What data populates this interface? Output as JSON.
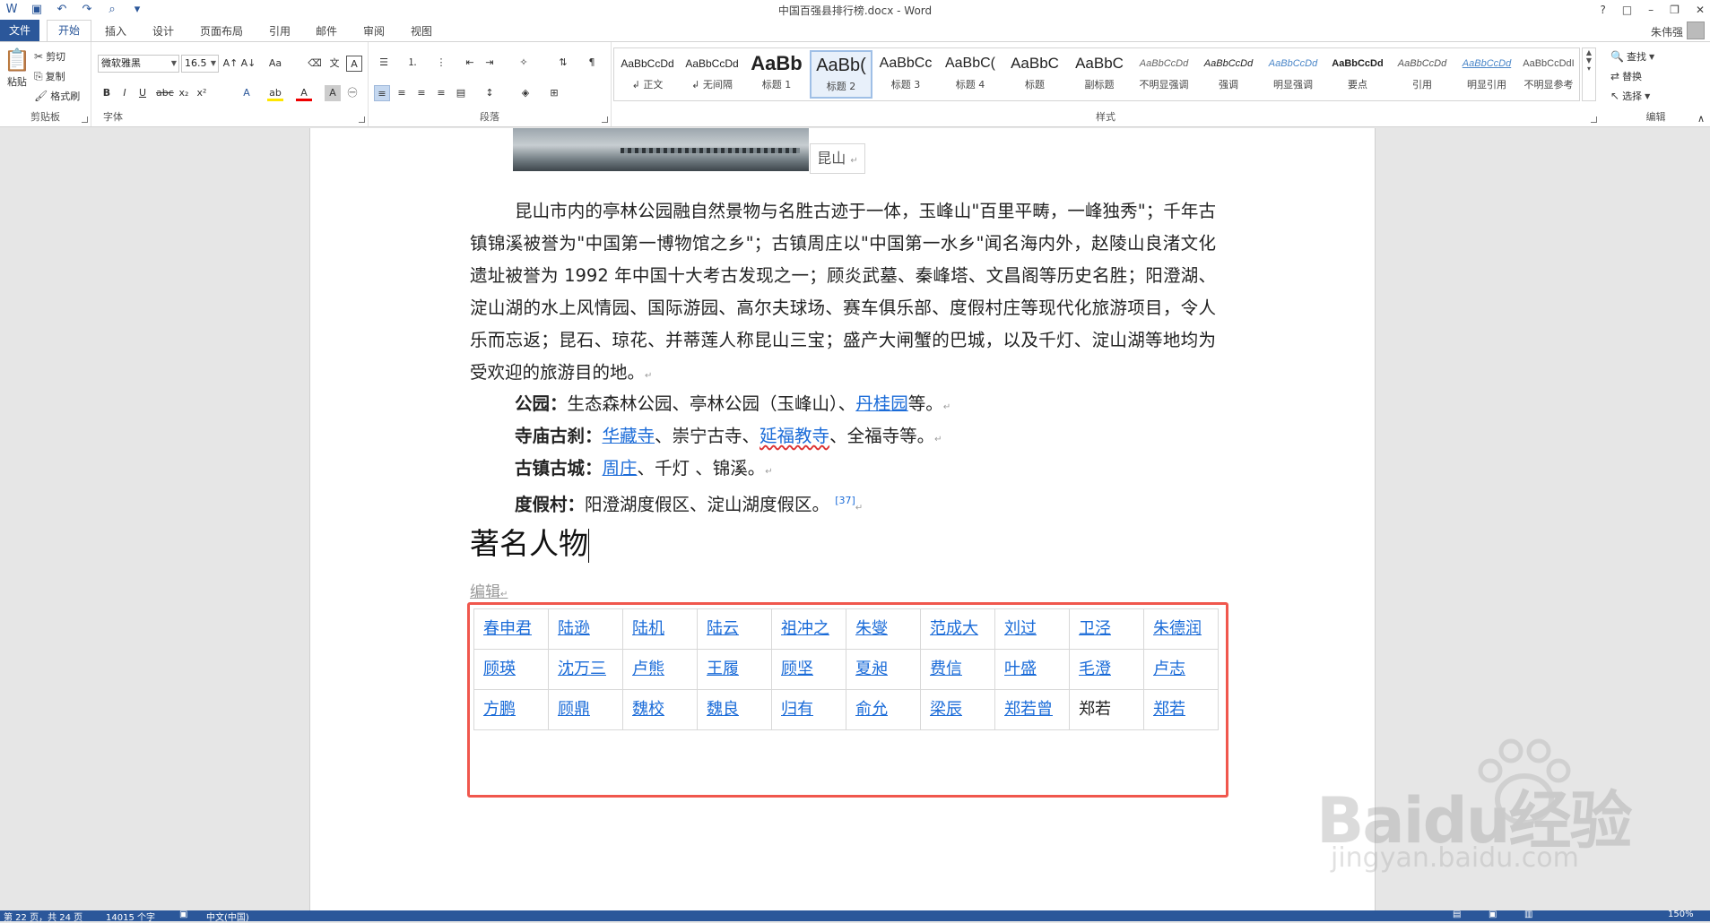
{
  "window": {
    "doc_title": "中国百强县排行榜.docx - Word",
    "controls": [
      "?",
      "□",
      "–",
      "❐",
      "✕"
    ]
  },
  "tabs": {
    "file": "文件",
    "items": [
      "开始",
      "插入",
      "设计",
      "页面布局",
      "引用",
      "邮件",
      "审阅",
      "视图"
    ],
    "active": "开始",
    "user": "朱伟强"
  },
  "ribbon": {
    "clipboard": {
      "paste": "粘贴",
      "cut": "剪切",
      "copy": "复制",
      "format_painter": "格式刷",
      "label": "剪贴板"
    },
    "font": {
      "font_name": "微软雅黑",
      "font_size": "16.5",
      "label": "字体"
    },
    "paragraph": {
      "label": "段落"
    },
    "styles": {
      "label": "样式",
      "items": [
        {
          "sample": "AaBbCcDd",
          "name": "↲ 正文"
        },
        {
          "sample": "AaBbCcDd",
          "name": "↲ 无间隔"
        },
        {
          "sample": "AaBb",
          "name": "标题 1"
        },
        {
          "sample": "AaBb(",
          "name": "标题 2"
        },
        {
          "sample": "AaBbCc",
          "name": "标题 3"
        },
        {
          "sample": "AaBbC(",
          "name": "标题 4"
        },
        {
          "sample": "AaBbC",
          "name": "标题"
        },
        {
          "sample": "AaBbC",
          "name": "副标题"
        },
        {
          "sample": "AaBbCcDd",
          "name": "不明显强调"
        },
        {
          "sample": "AaBbCcDd",
          "name": "强调"
        },
        {
          "sample": "AaBbCcDd",
          "name": "明显强调"
        },
        {
          "sample": "AaBbCcDd",
          "name": "要点"
        },
        {
          "sample": "AaBbCcDd",
          "name": "引用"
        },
        {
          "sample": "AaBbCcDd",
          "name": "明显引用"
        },
        {
          "sample": "AaBbCcDdI",
          "name": "不明显参考"
        }
      ]
    },
    "editing": {
      "find": "查找",
      "replace": "替换",
      "select": "选择",
      "label": "编辑"
    }
  },
  "document": {
    "caption": "昆山",
    "para1": "昆山市内的亭林公园融自然景物与名胜古迹于一体，玉峰山\"百里平畴，一峰独秀\"；千年古镇锦溪被誉为\"中国第一博物馆之乡\"；古镇周庄以\"中国第一水乡\"闻名海内外，赵陵山良渚文化遗址被誉为 1992 年中国十大考古发现之一；顾炎武墓、秦峰塔、文昌阁等历史名胜；阳澄湖、淀山湖的水上风情园、国际游园、高尔夫球场、赛车俱乐部、度假村庄等现代化旅游项目，令人乐而忘返；昆石、琼花、并蒂莲人称昆山三宝；盛产大闸蟹的巴城，以及千灯、淀山湖等地均为受欢迎的旅游目的地。",
    "line_park_label": "公园：",
    "line_park_a": "生态森林公园、亭林公园（玉峰山）、",
    "line_park_link": "丹桂园",
    "line_park_b": "等。",
    "line_temple_label": "寺庙古刹：",
    "line_temple_link1": "华藏寺",
    "line_temple_a": "、崇宁古寺、",
    "line_temple_link2": "延福教寺",
    "line_temple_b": "、全福寺等。",
    "line_town_label": "古镇古城：",
    "line_town_link": "周庄",
    "line_town_a": "、千灯 、锦溪。",
    "line_resort_label": "度假村：",
    "line_resort_a": "阳澄湖度假区、淀山湖度假区。",
    "line_resort_cite": "[37]",
    "heading": "著名人物",
    "edit_link": "编辑",
    "table": [
      [
        "春申君",
        "陆逊",
        "陆机",
        "陆云",
        "祖冲之",
        "朱燮",
        "范成大",
        "刘过",
        "卫泾",
        "朱德润"
      ],
      [
        "顾瑛",
        "沈万三",
        "卢熊",
        "王履",
        "顾坚",
        "夏昶",
        "费信",
        "叶盛",
        "毛澄",
        "卢志"
      ],
      [
        "方鹏",
        "顾鼎",
        "魏校",
        "魏良",
        "归有",
        "俞允",
        "梁辰",
        "郑若曾",
        "郑若",
        "郑若"
      ]
    ]
  },
  "status": {
    "page": "第 22 页，共 24 页",
    "words": "14015 个字",
    "lang": "中文(中国)",
    "zoom": "150%"
  },
  "watermark": {
    "main": "Baidu经验",
    "sub": "jingyan.baidu.com"
  },
  "colors": {
    "accent": "#2b579a",
    "link": "#1a6bd8",
    "highlight_box": "#f0574d"
  }
}
